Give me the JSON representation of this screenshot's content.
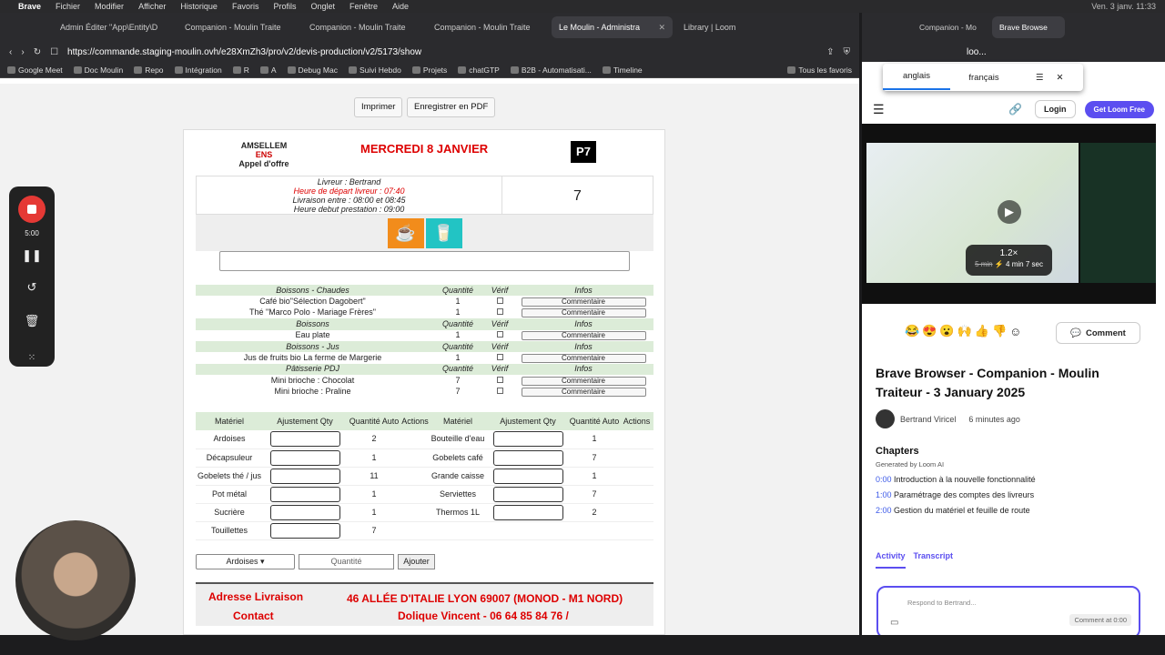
{
  "menubar": {
    "app": "Brave",
    "items": [
      "Fichier",
      "Modifier",
      "Afficher",
      "Historique",
      "Favoris",
      "Profils",
      "Onglet",
      "Fenêtre",
      "Aide"
    ],
    "clock": "Ven. 3 janv. 11:33"
  },
  "left_browser": {
    "tabs": [
      "Admin Éditer \"App\\Entity\\D",
      "Companion - Moulin Traite",
      "Companion - Moulin Traite",
      "Companion - Moulin Traite",
      "Le Moulin - Administra",
      "Library | Loom"
    ],
    "url": "https://commande.staging-moulin.ovh/e28XmZh3/pro/v2/devis-production/v2/5173/show",
    "bookmarks": [
      "Google Meet",
      "Doc Moulin",
      "Repo",
      "Intégration",
      "R",
      "A",
      "Debug Mac",
      "Suivi Hebdo",
      "Projets",
      "chatGTP",
      "B2B - Automatisati...",
      "Timeline",
      "Tous les favoris"
    ]
  },
  "page": {
    "print_label": "Imprimer",
    "pdf_label": "Enregistrer en PDF",
    "client": "AMSELLEM",
    "client_sub": "ENS",
    "offer": "Appel d'offre",
    "date": "MERCREDI 8 JANVIER",
    "code": "P7",
    "info": {
      "driver": "Livreur : Bertrand",
      "departure": "Heure de départ livreur : 07:40",
      "window": "Livraison entre : 08:00 et 08:45",
      "start": "Heure debut prestation : 09:00",
      "count": "7"
    },
    "icons": [
      "coffee-icon",
      "water-glass-icon"
    ],
    "drink_sections": [
      {
        "title": "Boissons - Chaudes",
        "items": [
          {
            "name": "Café bio\"Sélection Dagobert\"",
            "qty": "1"
          },
          {
            "name": "Thé \"Marco Polo - Mariage Frères\"",
            "qty": "1"
          }
        ]
      },
      {
        "title": "Boissons",
        "items": [
          {
            "name": "Eau plate",
            "qty": "1"
          }
        ]
      },
      {
        "title": "Boissons - Jus",
        "items": [
          {
            "name": "Jus de fruits bio La ferme de Margerie",
            "qty": "1"
          }
        ]
      },
      {
        "title": "Pâtisserie PDJ",
        "items": [
          {
            "name": "Mini brioche : Chocolat",
            "qty": "7"
          },
          {
            "name": "Mini brioche : Praline",
            "qty": "7"
          }
        ]
      }
    ],
    "drink_headers": {
      "qty": "Quantité",
      "check": "Vérif",
      "info": "Infos",
      "comment": "Commentaire"
    },
    "material_headers": [
      "Matériel",
      "Ajustement Qty",
      "Quantité Auto",
      "Actions"
    ],
    "material_left": [
      {
        "name": "Ardoises",
        "auto": "2"
      },
      {
        "name": "Décapsuleur",
        "auto": "1"
      },
      {
        "name": "Gobelets thé / jus",
        "auto": "11"
      },
      {
        "name": "Pot métal",
        "auto": "1"
      },
      {
        "name": "Sucrière",
        "auto": "1"
      },
      {
        "name": "Touillettes",
        "auto": "7"
      }
    ],
    "material_right": [
      {
        "name": "Bouteille d'eau",
        "auto": "1"
      },
      {
        "name": "Gobelets café",
        "auto": "7"
      },
      {
        "name": "Grande caisse",
        "auto": "1"
      },
      {
        "name": "Serviettes",
        "auto": "7"
      },
      {
        "name": "Thermos 1L",
        "auto": "2"
      }
    ],
    "add": {
      "select": "Ardoises",
      "qty_placeholder": "Quantité",
      "button": "Ajouter"
    },
    "address_label": "Adresse Livraison",
    "address": "46 ALLÉE D'ITALIE LYON 69007 (MONOD - M1 NORD)",
    "contact_label": "Contact",
    "contact": "Dolique Vincent - 06 64 85 84 76 /"
  },
  "recorder": {
    "time": "5:00"
  },
  "right_browser": {
    "tabs": [
      "Companion - Mo",
      "Brave Browse"
    ],
    "url": "loo...",
    "translate": {
      "from": "anglais",
      "to": "français"
    },
    "login": "Login",
    "get_loom": "Get Loom Free",
    "video": {
      "speed": "1.2×",
      "old_time": "5 min",
      "new_time": "4 min 7 sec"
    },
    "comment_btn": "Comment",
    "title": "Brave Browser - Companion - Moulin Traiteur - 3 January 2025",
    "author": "Bertrand Viricel",
    "posted": "6 minutes ago",
    "chapters_title": "Chapters",
    "chapters_sub": "Generated by Loom AI",
    "chapters": [
      {
        "t": "0:00",
        "label": "Introduction à la nouvelle fonctionnalité"
      },
      {
        "t": "1:00",
        "label": "Paramétrage des comptes des livreurs"
      },
      {
        "t": "2:00",
        "label": "Gestion du matériel et feuille de route"
      }
    ],
    "activity": "Activity",
    "transcript": "Transcript",
    "reply_placeholder": "Respond to Bertrand...",
    "comment_at": "Comment at 0:00"
  }
}
